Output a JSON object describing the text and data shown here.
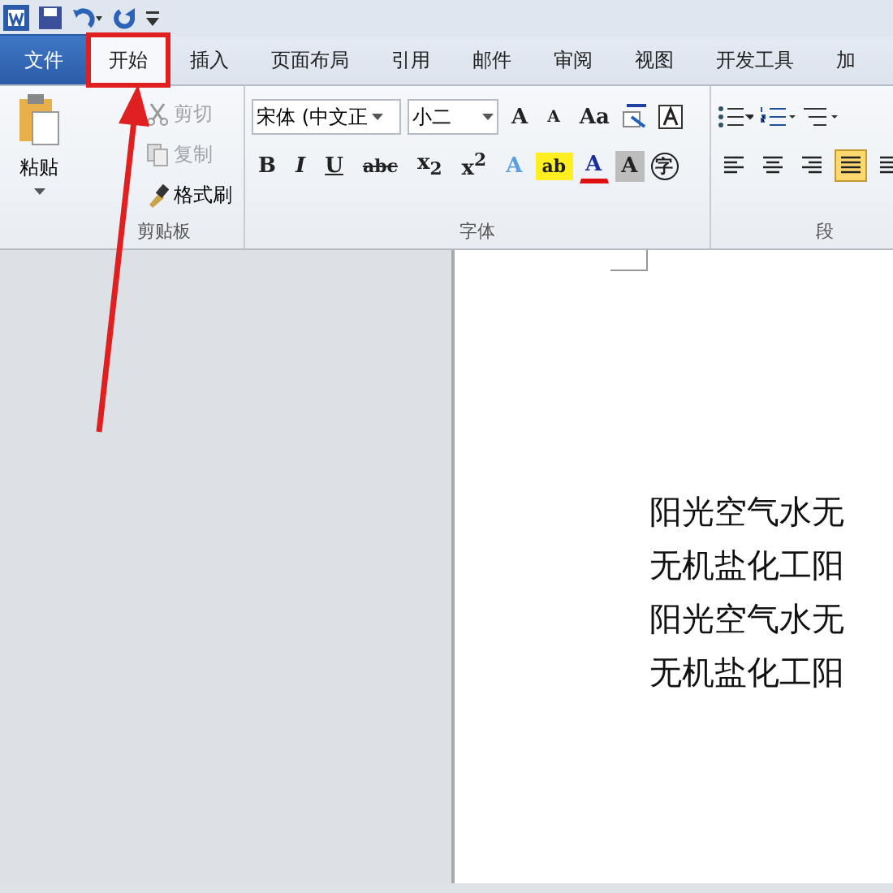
{
  "tabs": [
    {
      "label": "文件",
      "kind": "file",
      "selected": false,
      "highlighted": false
    },
    {
      "label": "开始",
      "kind": "tab",
      "selected": true,
      "highlighted": true
    },
    {
      "label": "插入",
      "kind": "tab",
      "selected": false,
      "highlighted": false
    },
    {
      "label": "页面布局",
      "kind": "tab",
      "selected": false,
      "highlighted": false
    },
    {
      "label": "引用",
      "kind": "tab",
      "selected": false,
      "highlighted": false
    },
    {
      "label": "邮件",
      "kind": "tab",
      "selected": false,
      "highlighted": false
    },
    {
      "label": "审阅",
      "kind": "tab",
      "selected": false,
      "highlighted": false
    },
    {
      "label": "视图",
      "kind": "tab",
      "selected": false,
      "highlighted": false
    },
    {
      "label": "开发工具",
      "kind": "tab",
      "selected": false,
      "highlighted": false
    },
    {
      "label": "加",
      "kind": "tab",
      "selected": false,
      "highlighted": false
    }
  ],
  "clipboard": {
    "label": "剪贴板",
    "paste": "粘贴",
    "items": [
      {
        "label": "剪切",
        "kind": "cut",
        "disabled": true
      },
      {
        "label": "复制",
        "kind": "copy",
        "disabled": true
      },
      {
        "label": "格式刷",
        "kind": "painter",
        "disabled": false
      }
    ]
  },
  "font": {
    "label": "字体",
    "font_name": "宋体 (中文正",
    "font_size": "小二",
    "row1": [
      {
        "label": "A",
        "kind": "grow"
      },
      {
        "label": "A",
        "kind": "shrink"
      },
      {
        "label": "Aa",
        "kind": "case"
      }
    ],
    "row2": [
      {
        "label": "B",
        "kind": "bold"
      },
      {
        "label": "I",
        "kind": "italic"
      },
      {
        "label": "U",
        "kind": "underline"
      },
      {
        "label": "abc",
        "kind": "strike"
      },
      {
        "label": "x$_{2}$",
        "kind": "sub"
      },
      {
        "label": "x$^{2}$",
        "kind": "sup"
      }
    ],
    "row2b": [
      {
        "label": "A",
        "kind": "effect"
      },
      {
        "label": "ab",
        "kind": "highlight"
      },
      {
        "label": "A",
        "kind": "color"
      },
      {
        "label": "A",
        "kind": "shade"
      },
      {
        "label": "字",
        "kind": "enclose"
      }
    ]
  },
  "paragraph": {
    "label": "段",
    "align": [
      {
        "kind": "left",
        "selected": false
      },
      {
        "kind": "center",
        "selected": false
      },
      {
        "kind": "right",
        "selected": false
      },
      {
        "kind": "justify",
        "selected": true
      },
      {
        "kind": "distribute",
        "selected": false
      }
    ]
  },
  "document": {
    "paragraphs": [
      "阳光空气水无",
      "无机盐化工阳",
      "阳光空气水无",
      "无机盐化工阳"
    ]
  }
}
